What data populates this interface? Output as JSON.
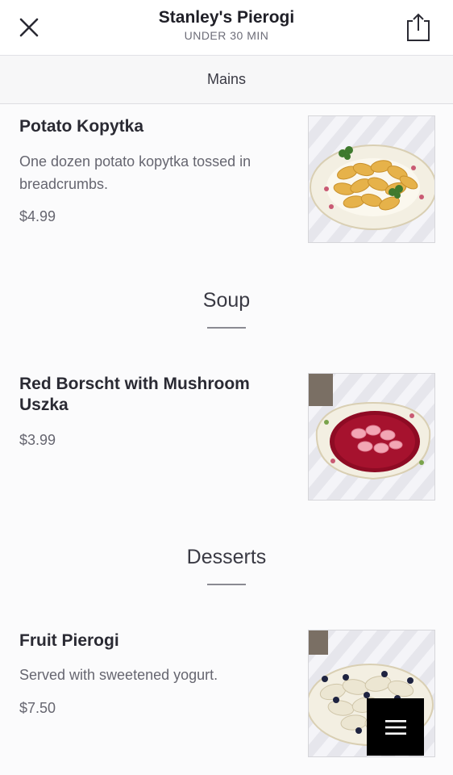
{
  "header": {
    "title": "Stanley's Pierogi",
    "subtitle": "UNDER 30 MIN",
    "close_icon": "close-icon",
    "share_icon": "share-icon"
  },
  "tabbar": {
    "active_tab": "Mains"
  },
  "items": [
    {
      "name": "Potato Kopytka",
      "description": "One dozen potato kopytka tossed in breadcrumbs.",
      "price": "$4.99"
    },
    {
      "name": "Red Borscht with Mushroom Uszka",
      "description": "",
      "price": "$3.99"
    },
    {
      "name": "Fruit Pierogi",
      "description": "Served with sweetened yogurt.",
      "price": "$7.50"
    }
  ],
  "sections": [
    {
      "title": "Soup"
    },
    {
      "title": "Desserts"
    }
  ],
  "fab": {
    "icon": "hamburger-menu-icon"
  },
  "colors": {
    "text_primary": "#2a2a33",
    "text_secondary": "#666670",
    "fab_background": "#000000",
    "borscht_red": "#8e0b24"
  }
}
